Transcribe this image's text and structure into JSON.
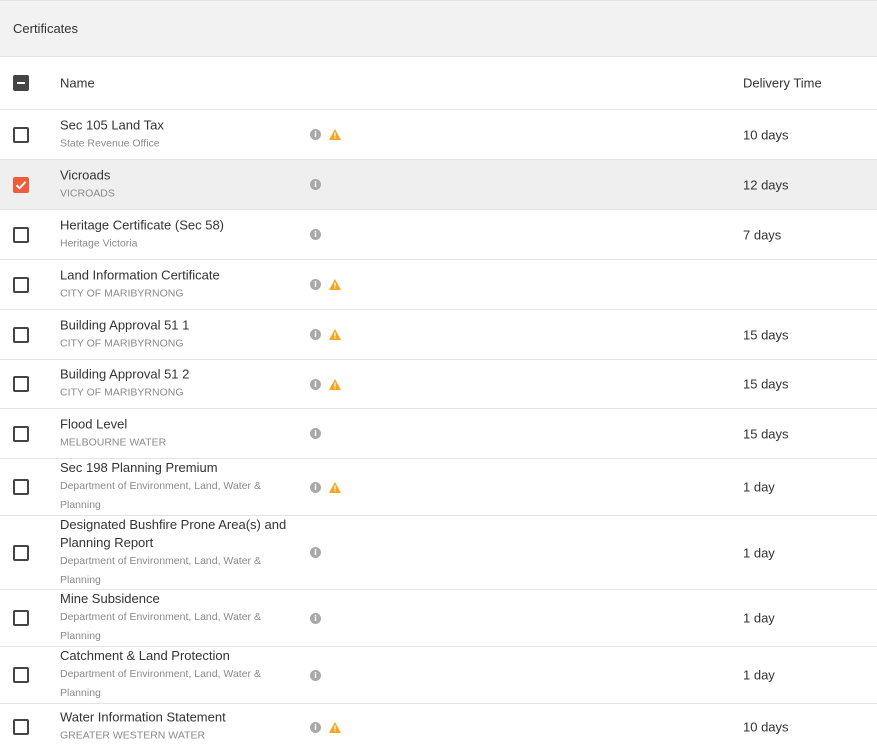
{
  "panel": {
    "title": "Certificates"
  },
  "table": {
    "columns": {
      "name": "Name",
      "delivery_time": "Delivery Time"
    },
    "rows": [
      {
        "name": "Sec 105 Land Tax",
        "authority": "State Revenue Office",
        "delivery": "10 days",
        "checked": false,
        "warning": true
      },
      {
        "name": "Vicroads",
        "authority": "VICROADS",
        "delivery": "12 days",
        "checked": true,
        "warning": false
      },
      {
        "name": "Heritage Certificate (Sec 58)",
        "authority": "Heritage Victoria",
        "delivery": "7 days",
        "checked": false,
        "warning": false
      },
      {
        "name": "Land Information Certificate",
        "authority": "CITY OF MARIBYRNONG",
        "delivery": "",
        "checked": false,
        "warning": true
      },
      {
        "name": "Building Approval 51 1",
        "authority": "CITY OF MARIBYRNONG",
        "delivery": "15 days",
        "checked": false,
        "warning": true
      },
      {
        "name": "Building Approval 51 2",
        "authority": "CITY OF MARIBYRNONG",
        "delivery": "15 days",
        "checked": false,
        "warning": true
      },
      {
        "name": "Flood Level",
        "authority": "MELBOURNE WATER",
        "delivery": "15 days",
        "checked": false,
        "warning": false
      },
      {
        "name": "Sec 198 Planning Premium",
        "authority": "Department of Environment, Land, Water & Planning",
        "delivery": "1 day",
        "checked": false,
        "warning": true
      },
      {
        "name": "Designated Bushfire Prone Area(s) and Planning Report",
        "authority": "Department of Environment, Land, Water & Planning",
        "delivery": "1 day",
        "checked": false,
        "warning": false
      },
      {
        "name": "Mine Subsidence",
        "authority": "Department of Environment, Land, Water & Planning",
        "delivery": "1 day",
        "checked": false,
        "warning": false
      },
      {
        "name": "Catchment & Land Protection",
        "authority": "Department of Environment, Land, Water & Planning",
        "delivery": "1 day",
        "checked": false,
        "warning": false
      },
      {
        "name": "Water Information Statement",
        "authority": "GREATER WESTERN WATER",
        "delivery": "10 days",
        "checked": false,
        "warning": true
      }
    ]
  },
  "icons": {
    "info": "info-icon",
    "warning": "warning-icon",
    "info_glyph": "i"
  },
  "colors": {
    "checked": "#f15a3a",
    "warning": "#f5a623",
    "info": "#a9a9a9"
  }
}
